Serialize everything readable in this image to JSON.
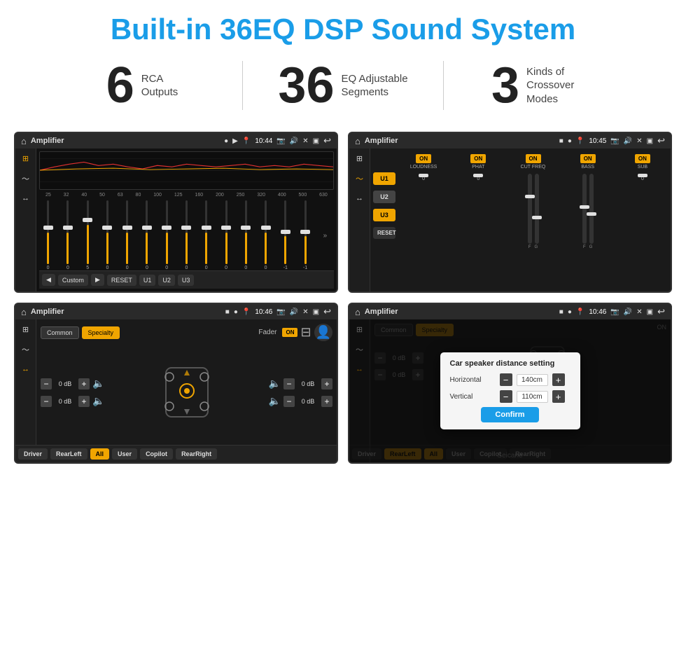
{
  "header": {
    "title": "Built-in 36EQ DSP Sound System"
  },
  "stats": [
    {
      "number": "6",
      "label_line1": "RCA",
      "label_line2": "Outputs"
    },
    {
      "number": "36",
      "label_line1": "EQ Adjustable",
      "label_line2": "Segments"
    },
    {
      "number": "3",
      "label_line1": "Kinds of",
      "label_line2": "Crossover Modes"
    }
  ],
  "screens": {
    "eq": {
      "topbar": {
        "title": "Amplifier",
        "time": "10:44"
      },
      "frequencies": [
        "25",
        "32",
        "40",
        "50",
        "63",
        "80",
        "100",
        "125",
        "160",
        "200",
        "250",
        "320",
        "400",
        "500",
        "630"
      ],
      "values": [
        "0",
        "0",
        "5",
        "0",
        "0",
        "0",
        "0",
        "0",
        "0",
        "0",
        "0",
        "0",
        "-1",
        "-1"
      ],
      "buttons": [
        "Custom",
        "RESET",
        "U1",
        "U2",
        "U3"
      ]
    },
    "crossover": {
      "topbar": {
        "title": "Amplifier",
        "time": "10:45"
      },
      "u_buttons": [
        "U1",
        "U2",
        "U3"
      ],
      "columns": [
        {
          "label": "LOUDNESS",
          "on": true
        },
        {
          "label": "PHAT",
          "on": true
        },
        {
          "label": "CUT FREQ",
          "on": true
        },
        {
          "label": "BASS",
          "on": true
        },
        {
          "label": "SUB",
          "on": true
        }
      ],
      "reset_label": "RESET"
    },
    "fader": {
      "topbar": {
        "title": "Amplifier",
        "time": "10:46"
      },
      "mode_buttons": [
        "Common",
        "Specialty"
      ],
      "active_mode": "Specialty",
      "fader_label": "Fader",
      "on_label": "ON",
      "channels": [
        {
          "value": "0 dB"
        },
        {
          "value": "0 dB"
        },
        {
          "value": "0 dB"
        },
        {
          "value": "0 dB"
        }
      ],
      "bottom_buttons": [
        "Driver",
        "RearLeft",
        "All",
        "User",
        "Copilot",
        "RearRight"
      ]
    },
    "dialog": {
      "topbar": {
        "title": "Amplifier",
        "time": "10:46"
      },
      "dialog": {
        "title": "Car speaker distance setting",
        "rows": [
          {
            "label": "Horizontal",
            "value": "140cm"
          },
          {
            "label": "Vertical",
            "value": "110cm"
          }
        ],
        "confirm_label": "Confirm"
      },
      "channels": [
        {
          "value": "0 dB"
        },
        {
          "value": "0 dB"
        }
      ],
      "bottom_buttons": [
        "Driver",
        "RearLeft",
        "All",
        "User",
        "Copilot",
        "RearRight"
      ]
    }
  },
  "watermark": "Seicane"
}
